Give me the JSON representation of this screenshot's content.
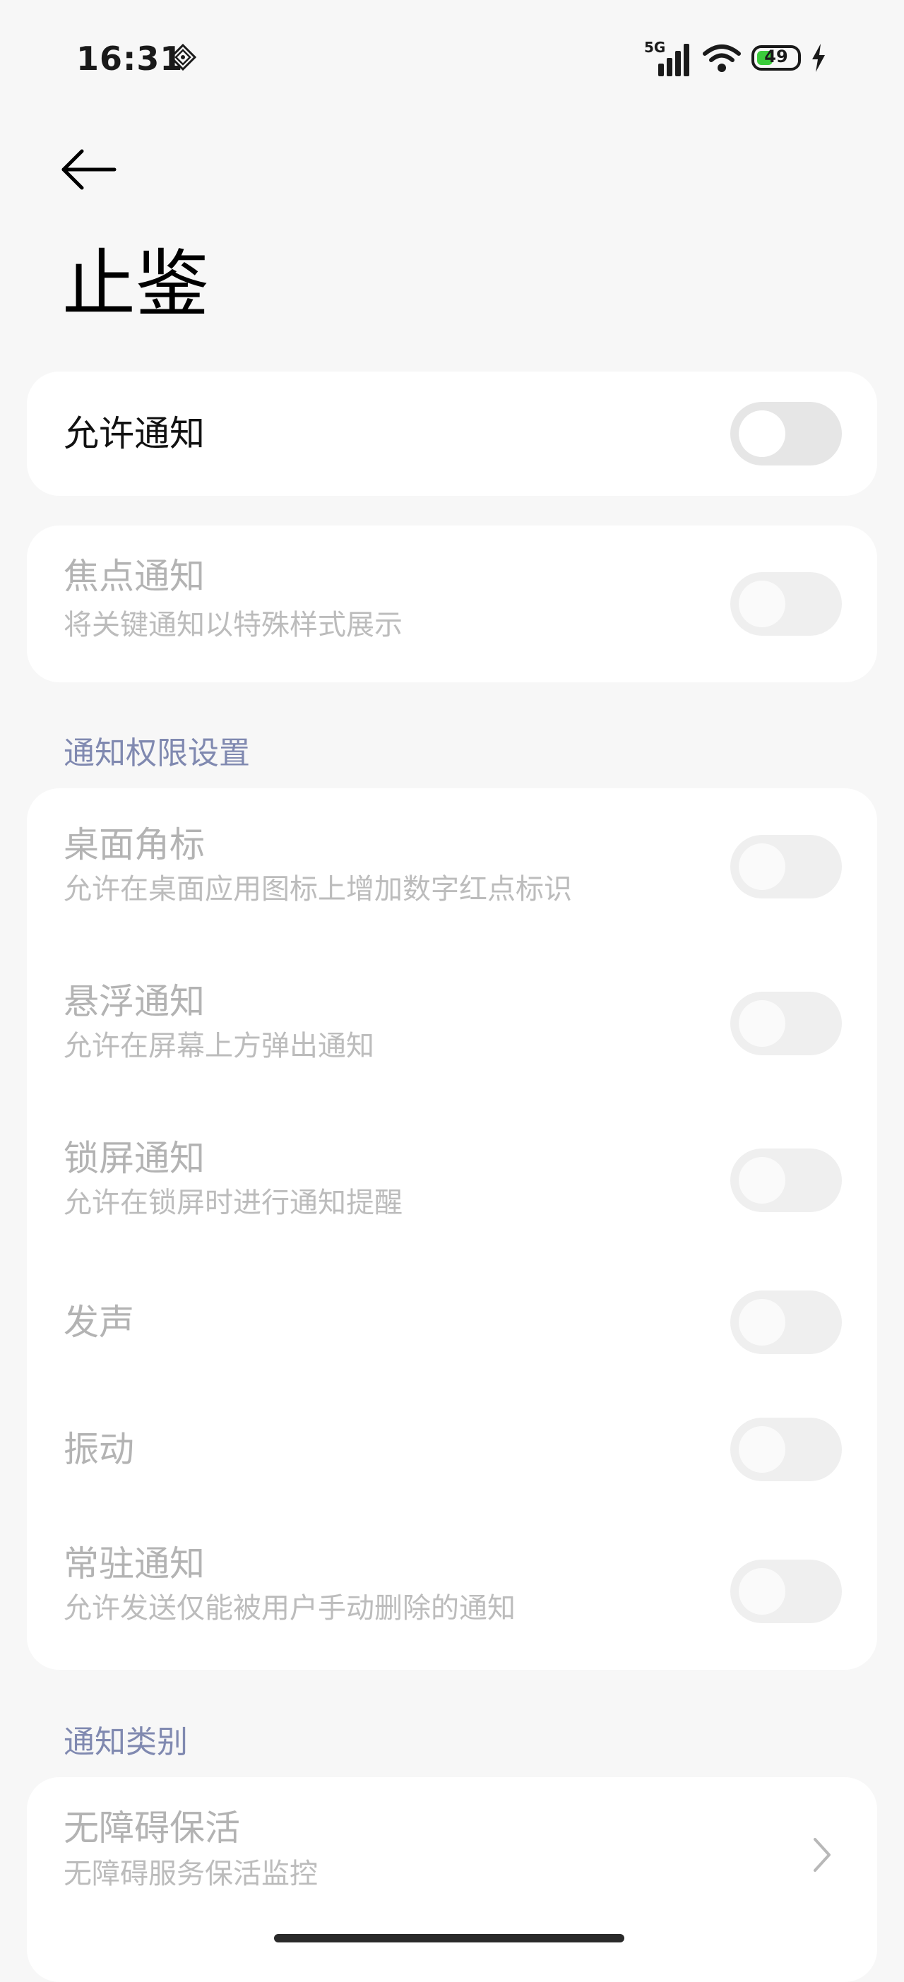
{
  "status_bar": {
    "time": "16:31",
    "network": "5G",
    "battery_level": "49",
    "battery_percent": 49,
    "icons": [
      "app-notification-icon",
      "signal-icon",
      "wifi-icon",
      "battery-icon",
      "charging-icon"
    ]
  },
  "header": {
    "title": "止鉴",
    "back_icon": "back-arrow-icon"
  },
  "main_toggle": {
    "label": "允许通知",
    "on": false
  },
  "focus": {
    "label": "焦点通知",
    "description": "将关键通知以特殊样式展示",
    "on": false
  },
  "permissions": {
    "section_label": "通知权限设置",
    "items": [
      {
        "label": "桌面角标",
        "description": "允许在桌面应用图标上增加数字红点标识",
        "on": false
      },
      {
        "label": "悬浮通知",
        "description": "允许在屏幕上方弹出通知",
        "on": false
      },
      {
        "label": "锁屏通知",
        "description": "允许在锁屏时进行通知提醒",
        "on": false
      },
      {
        "label": "发声",
        "description": "",
        "on": false
      },
      {
        "label": "振动",
        "description": "",
        "on": false
      },
      {
        "label": "常驻通知",
        "description": "允许发送仅能被用户手动删除的通知",
        "on": false
      }
    ]
  },
  "categories": {
    "section_label": "通知类别",
    "items": [
      {
        "label": "无障碍保活",
        "description": "无障碍服务保活监控"
      }
    ]
  },
  "colors": {
    "background": "#f7f7f7",
    "card": "#ffffff",
    "section_label": "#8089b0",
    "battery_fill": "#3bcc3b"
  }
}
